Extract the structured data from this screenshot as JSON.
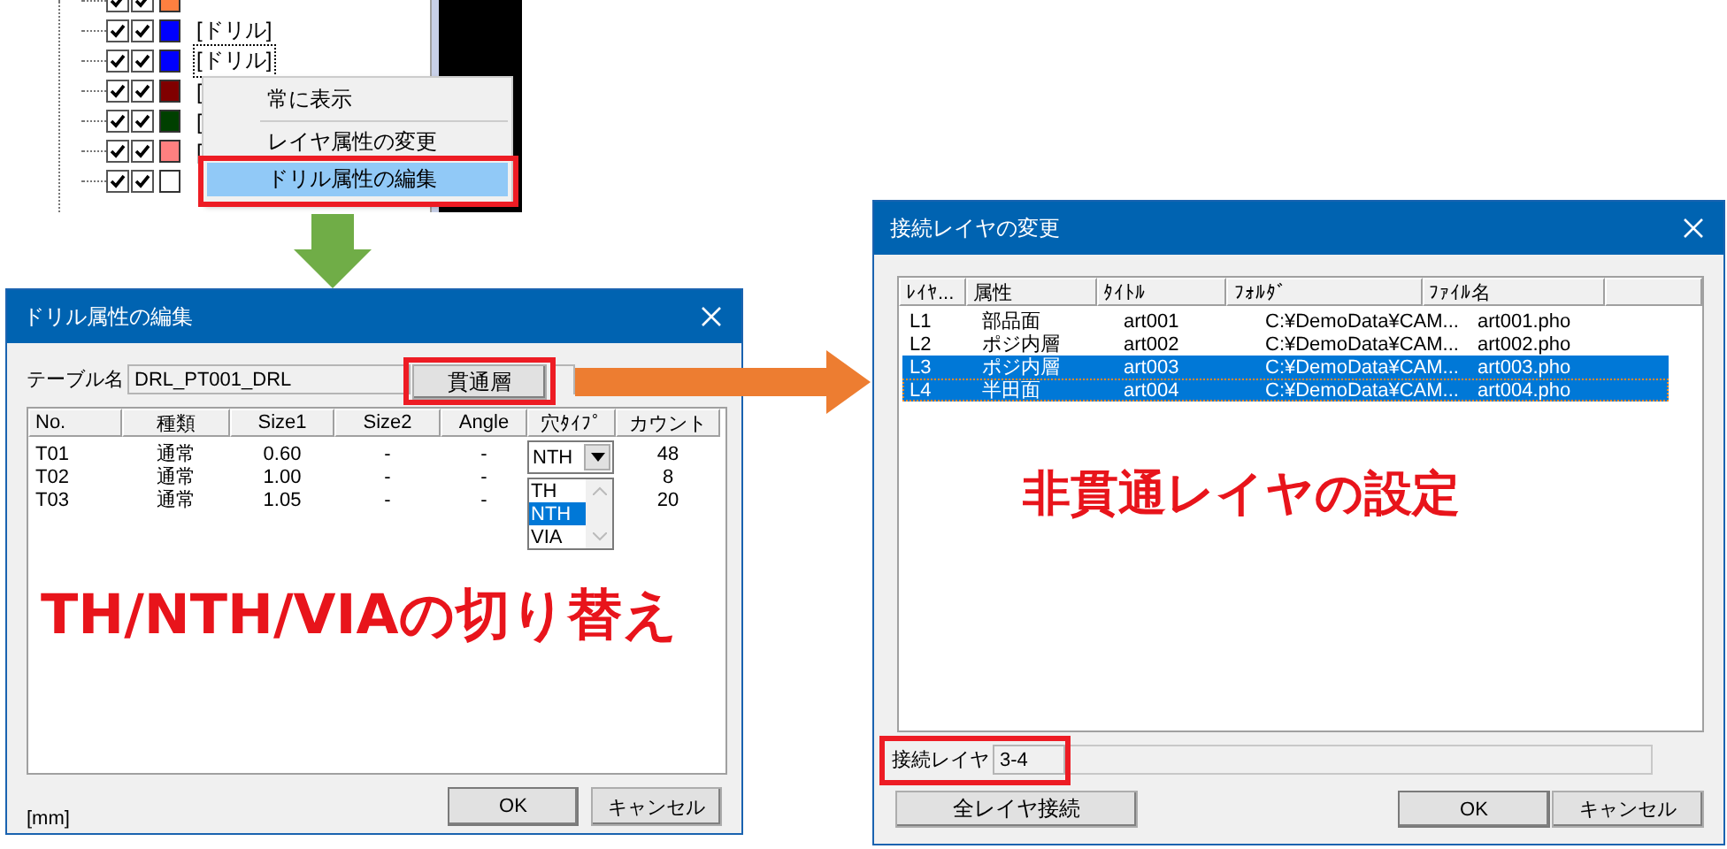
{
  "tree_panel": {
    "rows": [
      {
        "checked_a": true,
        "checked_b": true,
        "color": "#ff8040"
      },
      {
        "checked_a": true,
        "checked_b": true,
        "color": "#0000ff",
        "label": "[ドリル]",
        "focused": false
      },
      {
        "checked_a": true,
        "checked_b": true,
        "color": "#0000ff",
        "label": "[ドリル]",
        "focused": true
      },
      {
        "checked_a": true,
        "checked_b": true,
        "color": "#800000",
        "label": "[",
        "focused": false
      },
      {
        "checked_a": true,
        "checked_b": true,
        "color": "#004000",
        "label": "[",
        "focused": false
      },
      {
        "checked_a": true,
        "checked_b": true,
        "color": "#ff8080",
        "label": "[",
        "focused": false
      },
      {
        "checked_a": true,
        "checked_b": true,
        "color": "#ffffff"
      }
    ]
  },
  "context_menu": {
    "items": [
      {
        "label": "常に表示",
        "selected": false,
        "separator_after": true
      },
      {
        "label": "レイヤ属性の変更",
        "selected": false,
        "separator_after": false
      },
      {
        "label": "ドリル属性の編集",
        "selected": true,
        "separator_after": false
      }
    ]
  },
  "drill_dialog": {
    "title": "ドリル属性の編集",
    "table_name_label": "テーブル名",
    "table_name": "DRL_PT001_DRL",
    "through_button": "貫通層",
    "columns": [
      "No.",
      "種類",
      "Size1",
      "Size2",
      "Angle",
      "穴ﾀｲﾌﾟ",
      "カウント"
    ],
    "rows": [
      {
        "no": "T01",
        "type": "通常",
        "size1": "0.60",
        "size2": "-",
        "angle": "-",
        "count": "48"
      },
      {
        "no": "T02",
        "type": "通常",
        "size1": "1.00",
        "size2": "-",
        "angle": "-",
        "count": "8"
      },
      {
        "no": "T03",
        "type": "通常",
        "size1": "1.05",
        "size2": "-",
        "angle": "-",
        "count": "20"
      }
    ],
    "hole_type": {
      "value": "NTH",
      "options": [
        {
          "label": "TH",
          "selected": false
        },
        {
          "label": "NTH",
          "selected": true
        },
        {
          "label": "VIA",
          "selected": false
        }
      ]
    },
    "caption": "TH/NTH/VIAの切り替え",
    "unit": "[mm]",
    "buttons": [
      "OK",
      "キャンセル"
    ]
  },
  "layer_dialog": {
    "title": "接続レイヤの変更",
    "columns": [
      "ﾚｲﾔ...",
      "属性",
      "ﾀｲﾄﾙ",
      "ﾌｫﾙﾀﾞ",
      "ﾌｧｲﾙ名"
    ],
    "rows": [
      {
        "layer": "L1",
        "attribute": "部品面",
        "title": "art001",
        "folder": "C:¥DemoData¥CAM...",
        "file": "art001.pho",
        "selected": false,
        "focused": false
      },
      {
        "layer": "L2",
        "attribute": "ポジ内層",
        "title": "art002",
        "folder": "C:¥DemoData¥CAM...",
        "file": "art002.pho",
        "selected": false,
        "focused": false
      },
      {
        "layer": "L3",
        "attribute": "ポジ内層",
        "title": "art003",
        "folder": "C:¥DemoData¥CAM...",
        "file": "art003.pho",
        "selected": true,
        "focused": false
      },
      {
        "layer": "L4",
        "attribute": "半田面",
        "title": "art004",
        "folder": "C:¥DemoData¥CAM...",
        "file": "art004.pho",
        "selected": true,
        "focused": true
      }
    ],
    "caption": "非貫通レイヤの設定",
    "connect_label": "接続レイヤ",
    "connect_value": "3-4",
    "all_button": "全レイヤ接続",
    "buttons": [
      "OK",
      "キャンセル"
    ]
  }
}
